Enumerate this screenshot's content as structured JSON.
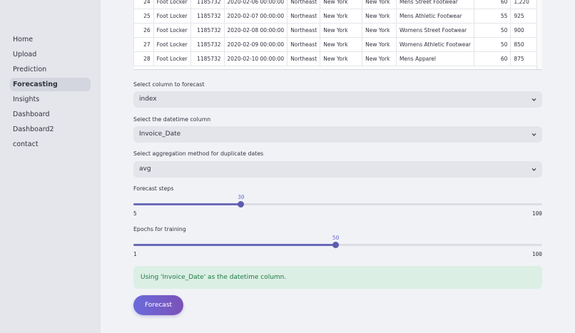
{
  "sidebar": {
    "items": [
      {
        "label": "Home"
      },
      {
        "label": "Upload"
      },
      {
        "label": "Prediction"
      },
      {
        "label": "Forecasting",
        "active": true
      },
      {
        "label": "Insights"
      },
      {
        "label": "Dashboard"
      },
      {
        "label": "Dashboard2"
      },
      {
        "label": "contact"
      }
    ]
  },
  "table": {
    "rows": [
      [
        "24",
        "Foot Locker",
        "1185732",
        "2020-02-06 00:00:00",
        "Northeast",
        "New York",
        "New York",
        "Mens Street Footwear",
        "60",
        "1,220"
      ],
      [
        "25",
        "Foot Locker",
        "1185732",
        "2020-02-07 00:00:00",
        "Northeast",
        "New York",
        "New York",
        "Mens Athletic Footwear",
        "55",
        "925"
      ],
      [
        "26",
        "Foot Locker",
        "1185732",
        "2020-02-08 00:00:00",
        "Northeast",
        "New York",
        "New York",
        "Womens Street Footwear",
        "50",
        "900"
      ],
      [
        "27",
        "Foot Locker",
        "1185732",
        "2020-02-09 00:00:00",
        "Northeast",
        "New York",
        "New York",
        "Womens Athletic Footwear",
        "50",
        "850"
      ],
      [
        "28",
        "Foot Locker",
        "1185732",
        "2020-02-10 00:00:00",
        "Northeast",
        "New York",
        "New York",
        "Mens Apparel",
        "60",
        "875"
      ]
    ]
  },
  "forecast_column": {
    "label": "Select column to forecast",
    "value": "index"
  },
  "datetime_column": {
    "label": "Select the datetime column",
    "value": "Invoice_Date"
  },
  "aggregation": {
    "label": "Select aggregation method for duplicate dates",
    "value": "avg"
  },
  "forecast_steps": {
    "label": "Forecast steps",
    "value": "30",
    "min": "5",
    "max": "100"
  },
  "epochs": {
    "label": "Epochs for training",
    "value": "50",
    "min": "1",
    "max": "100"
  },
  "success_message": "Using 'Invoice_Date' as the datetime column.",
  "forecast_button": "Forecast",
  "colors": {
    "accent": "#6a6bdc",
    "success_bg": "#dcefe5",
    "success_text": "#1e7a45"
  }
}
